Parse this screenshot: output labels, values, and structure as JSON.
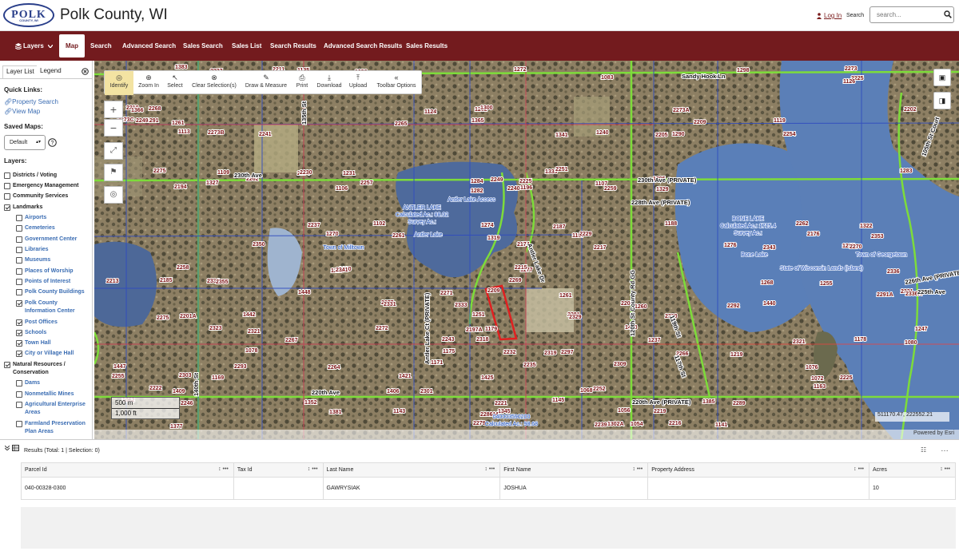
{
  "header": {
    "logo_text": "POLK",
    "logo_sub": "COUNTY, WI",
    "title": "Polk County, WI",
    "login_label": "Log In",
    "search_label": "Search",
    "search_placeholder": "search..."
  },
  "nav": {
    "items": [
      {
        "label": "Layers"
      },
      {
        "label": "Map"
      },
      {
        "label": "Search"
      },
      {
        "label": "Advanced Search"
      },
      {
        "label": "Sales Search"
      },
      {
        "label": "Sales List"
      },
      {
        "label": "Search Results"
      },
      {
        "label": "Advanced Search Results"
      },
      {
        "label": "Sales Results"
      }
    ],
    "active": "Map"
  },
  "sidebar": {
    "tabs": [
      {
        "label": "Layer List"
      },
      {
        "label": "Legend"
      }
    ],
    "quick_links_title": "Quick Links:",
    "quick_links": [
      {
        "label": "Property Search"
      },
      {
        "label": "View Map"
      }
    ],
    "saved_maps_title": "Saved Maps:",
    "saved_map_value": "Default",
    "layers_title": "Layers:",
    "layers": [
      {
        "label": "Districts / Voting",
        "checked": false,
        "level": 0
      },
      {
        "label": "Emergency Management",
        "checked": false,
        "level": 0
      },
      {
        "label": "Community Services",
        "checked": false,
        "level": 0
      },
      {
        "label": "Landmarks",
        "checked": true,
        "level": 0
      },
      {
        "label": "Airports",
        "checked": false,
        "level": 1
      },
      {
        "label": "Cemeteries",
        "checked": false,
        "level": 1
      },
      {
        "label": "Government Center",
        "checked": false,
        "level": 1
      },
      {
        "label": "Libraries",
        "checked": false,
        "level": 1
      },
      {
        "label": "Museums",
        "checked": false,
        "level": 1
      },
      {
        "label": "Places of Worship",
        "checked": false,
        "level": 1
      },
      {
        "label": "Points of Interest",
        "checked": false,
        "level": 1
      },
      {
        "label": "Polk County Buildings",
        "checked": false,
        "level": 1
      },
      {
        "label": "Polk County",
        "label2": "Information Center",
        "checked": true,
        "level": 1
      },
      {
        "label": "Post Offices",
        "checked": true,
        "level": 1
      },
      {
        "label": "Schools",
        "checked": true,
        "level": 1
      },
      {
        "label": "Town Hall",
        "checked": true,
        "level": 1
      },
      {
        "label": "City or Village Hall",
        "checked": true,
        "level": 1
      },
      {
        "label": "Natural Resources /",
        "label2": "Conservation",
        "checked": true,
        "level": 0
      },
      {
        "label": "Dams",
        "checked": false,
        "level": 1
      },
      {
        "label": "Nonmetallic Mines",
        "checked": false,
        "level": 1
      },
      {
        "label": "Agricultural Enterprise",
        "label2": "Areas",
        "checked": false,
        "level": 1
      },
      {
        "label": "Farmland Preservation",
        "label2": "Plan Areas",
        "checked": false,
        "level": 1
      }
    ]
  },
  "toolbar": {
    "tools": [
      {
        "label": "Identify",
        "icon": "identify-icon"
      },
      {
        "label": "Zoom In",
        "icon": "zoom-in-icon"
      },
      {
        "label": "Select",
        "icon": "select-cursor-icon"
      },
      {
        "label": "Clear Selection(s)",
        "icon": "clear-icon"
      },
      {
        "label": "Draw & Measure",
        "icon": "pencil-icon"
      },
      {
        "label": "Print",
        "icon": "printer-icon"
      },
      {
        "label": "Download",
        "icon": "download-icon"
      },
      {
        "label": "Upload",
        "icon": "upload-icon"
      },
      {
        "label": "Toolbar Options",
        "icon": "chevrons-left-icon"
      }
    ]
  },
  "map": {
    "roads": [
      {
        "label": "230th Ave"
      },
      {
        "label": "220th Ave"
      },
      {
        "label": "220th Ave (PRIVATE)"
      },
      {
        "label": "Sandy Hook Ln"
      },
      {
        "label": "230th Ave (PRIVATE)"
      },
      {
        "label": "228th Ave (PRIVATE)"
      },
      {
        "label": "226th Ave (PRIVATE)"
      },
      {
        "label": "225th Ave"
      },
      {
        "label": "120th St County Rd GG"
      },
      {
        "label": "117th St"
      },
      {
        "label": "140th St"
      },
      {
        "label": "135th St"
      },
      {
        "label": "Antler Lake Dr"
      },
      {
        "label": "Antler Lake Ct (PRIVATE)"
      },
      {
        "label": "119th St"
      },
      {
        "label": "105th St Court"
      }
    ],
    "places": [
      {
        "label": "ANTLER LAKE",
        "label2": "Calculated Ac.: 88.02",
        "label3": "Survey Ac.:"
      },
      {
        "label": "BONE LAKE",
        "label2": "Calculated Ac.: 1715.4",
        "label3": "Survey Ac.:"
      },
      {
        "label": "Antler Lake Access"
      },
      {
        "label": "Antler Lake"
      },
      {
        "label": "Town of Milltown"
      },
      {
        "label": "Bone Lake"
      },
      {
        "label": "Town of Georgetown"
      },
      {
        "label": "State of Wisconsin Lands (Island)"
      },
      {
        "label": "040003590200",
        "label2": "Calculated Ac.: 98.68"
      }
    ],
    "parcel_numbers": [
      "1272",
      "1294",
      "1262",
      "1261",
      "1240",
      "1231",
      "1205",
      "1196",
      "1188",
      "1167",
      "2350",
      "2336",
      "2334",
      "2321",
      "2333",
      "2330",
      "2321",
      "2318",
      "2297",
      "2293",
      "1421",
      "1409",
      "1352",
      "1345",
      "1302A",
      "1298",
      "1296",
      "1300",
      "1291",
      "1290",
      "1283",
      "1284",
      "1282",
      "1274",
      "1270",
      "1276",
      "1258",
      "1255",
      "2291A",
      "2292",
      "2281",
      "2272",
      "2267",
      "2266",
      "2264",
      "2255",
      "2252",
      "2246",
      "2244",
      "2239",
      "2227",
      "2225",
      "2210",
      "2209",
      "2205",
      "2204",
      "2202",
      "2194",
      "2187",
      "2176",
      "2174",
      "2180",
      "2185",
      "1448",
      "1440",
      "1442",
      "1450",
      "2243",
      "2232",
      "1447",
      "1425",
      "1406",
      "1385",
      "1381",
      "1377",
      "1383",
      "1386",
      "1366",
      "1365",
      "1341",
      "1333",
      "1327",
      "1329",
      "1322",
      "1319",
      "1297",
      "1277",
      "1268",
      "1261",
      "1260",
      "1251",
      "1247",
      "1237",
      "1219",
      "2235",
      "2225",
      "2222",
      "2221",
      "2219",
      "2216",
      "2211",
      "2209",
      "2202",
      "2249",
      "2241",
      "2230",
      "2257",
      "2259",
      "2262",
      "2261",
      "2270",
      "2258",
      "2269",
      "2271",
      "2277",
      "2275",
      "1179",
      "1178",
      "1175",
      "1171",
      "1169",
      "1163",
      "1145",
      "1143",
      "1141",
      "1135",
      "1126",
      "1124",
      "1119",
      "1113",
      "1109",
      "1107",
      "1106",
      "1102",
      "2353",
      "2343",
      "2341",
      "2355",
      "2336A",
      "2331",
      "2329",
      "2323",
      "2321",
      "2319",
      "2309",
      "2303",
      "2301",
      "2289",
      "2286",
      "2279",
      "2273",
      "2270",
      "2268",
      "2265",
      "2254",
      "2251",
      "2249",
      "2240",
      "2237",
      "2229",
      "2217",
      "2215",
      "2213",
      "2209",
      "2205",
      "2201A",
      "2197A",
      "1080",
      "1078",
      "1076",
      "1072",
      "1068",
      "1062",
      "1056",
      "1054",
      "1058",
      "1083",
      "2273A",
      "2273C",
      "2273B",
      "2275",
      "2225"
    ],
    "scale_m": "500 m",
    "scale_ft": "1,000 ft",
    "coords": "511170.47, 222552.21",
    "attribution": "Powered by Esri",
    "zoom_in_label": "+",
    "zoom_out_label": "−"
  },
  "results": {
    "title": "Results (Total: 1 | Selection: 0)",
    "columns": [
      {
        "label": "Parcel Id"
      },
      {
        "label": "Tax Id"
      },
      {
        "label": "Last Name"
      },
      {
        "label": "First Name"
      },
      {
        "label": "Property Address"
      },
      {
        "label": "Acres"
      }
    ],
    "rows": [
      [
        "040-00328-0300",
        "",
        "GAWRYSIAK",
        "JOSHUA",
        "",
        "10"
      ]
    ]
  },
  "colors": {
    "brand": "#731b1e",
    "link": "#3b6db3",
    "road_highlight": "#7ddc3a",
    "parcel_line": "#2f4bbf",
    "selected_parcel": "#e02020"
  }
}
